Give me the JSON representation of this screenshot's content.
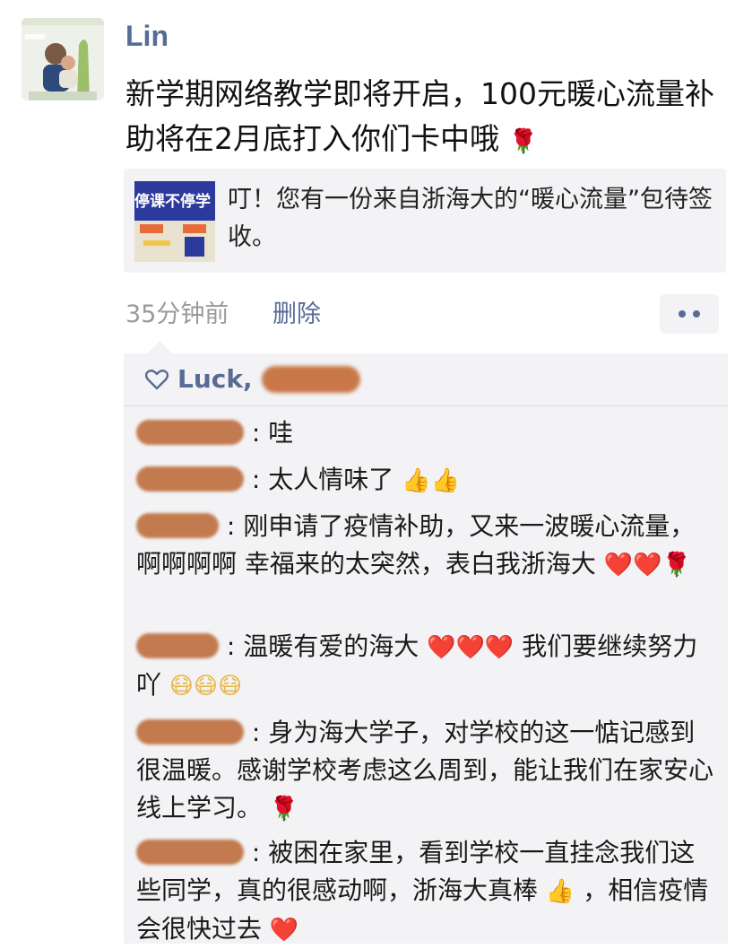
{
  "post": {
    "username": "Lin",
    "text": "新学期网络教学即将开启，100元暖心流量补助将在2月底打入你们卡中哦",
    "text_emoji": "🌹",
    "link_card": {
      "thumb_title": "停课不停学",
      "text": "叮！您有一份来自浙海大的“暖心流量”包待签收。"
    },
    "timestamp": "35分钟前",
    "delete_label": "删除"
  },
  "likes": {
    "icon": "heart-outline-icon",
    "names": "Luck,"
  },
  "comments": [
    {
      "text": ": 哇",
      "emoji": ""
    },
    {
      "text": ": 太人情味了",
      "emoji": "👍👍"
    },
    {
      "text": ": 刚申请了疫情补助，又来一波暖心流量，啊啊啊啊  幸福来的太突然，表白我浙海大",
      "emoji": "❤️❤️🌹"
    },
    {
      "text": ": 温暖有爱的海大",
      "emoji": "❤️❤️❤️",
      "text2": " 我们要继续努力吖",
      "emoji2": "😷😷😷"
    },
    {
      "text": ": 身为海大学子，对学校的这一惦记感到很温暖。感谢学校考虑这么周到，能让我们在家安心线上学习。",
      "emoji": "🌹"
    },
    {
      "text": ": 被困在家里，看到学校一直挂念我们这些同学，真的很感动啊，浙海大真棒",
      "emoji": "👍",
      "text2": "，相信疫情会很快过去",
      "emoji2": "❤️"
    }
  ],
  "colors": {
    "name_blue": "#576b95",
    "bubble_bg": "#f3f3f5"
  }
}
